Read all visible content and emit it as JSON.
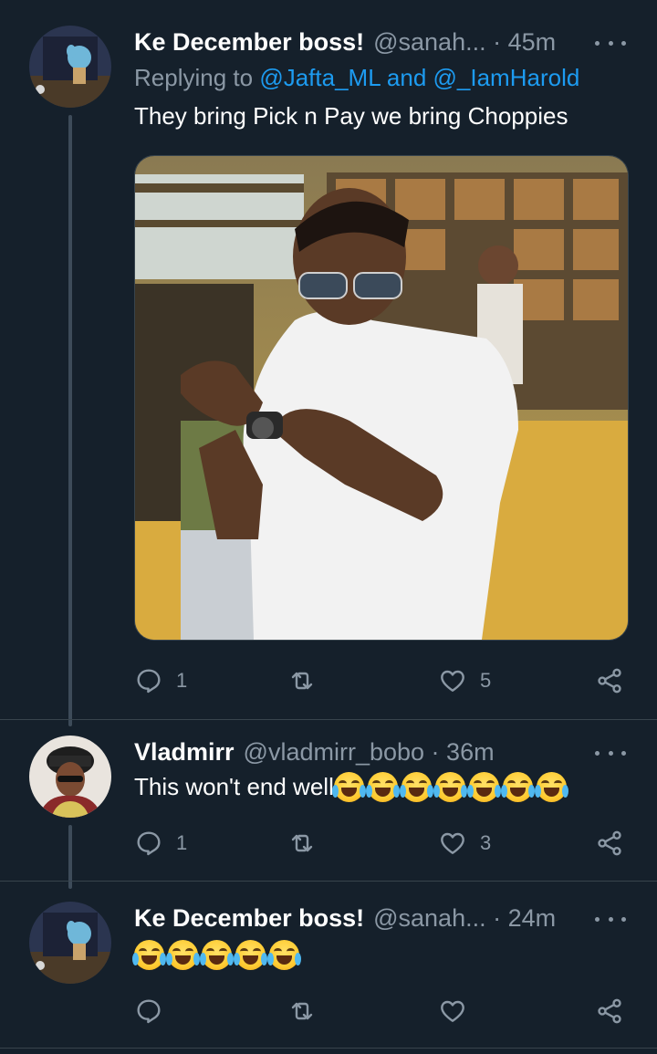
{
  "tweets": [
    {
      "name": "Ke December boss!",
      "handle": "@sanah...",
      "sep": " · ",
      "time": "45m",
      "reply_prefix": "Replying to ",
      "mention_1": "@Jafta_ML",
      "reply_and": " and ",
      "mention_2": "@_IamHarold",
      "text": "They bring Pick n Pay we bring Choppies",
      "replies": "1",
      "retweets": "",
      "likes": "5"
    },
    {
      "name": "Vladmirr",
      "handle": "@vladmirr_bobo",
      "sep": " · ",
      "time": "36m",
      "text": "This won't end well",
      "emoji_count": 7,
      "emoji_name": "face-with-tears-of-joy",
      "replies": "1",
      "retweets": "",
      "likes": "3"
    },
    {
      "name": "Ke December boss!",
      "handle": "@sanah...",
      "sep": " · ",
      "time": "24m",
      "text": "",
      "emoji_count": 5,
      "emoji_name": "face-with-tears-of-joy",
      "replies": "",
      "retweets": "",
      "likes": ""
    }
  ],
  "icons": {
    "reply": "reply-icon",
    "retweet": "retweet-icon",
    "like": "heart-icon",
    "share": "share-icon",
    "more": "more-icon"
  },
  "colors": {
    "background": "#15202b",
    "secondary_text": "#8b98a5",
    "link": "#1d9bf0",
    "divider": "#38444d"
  }
}
